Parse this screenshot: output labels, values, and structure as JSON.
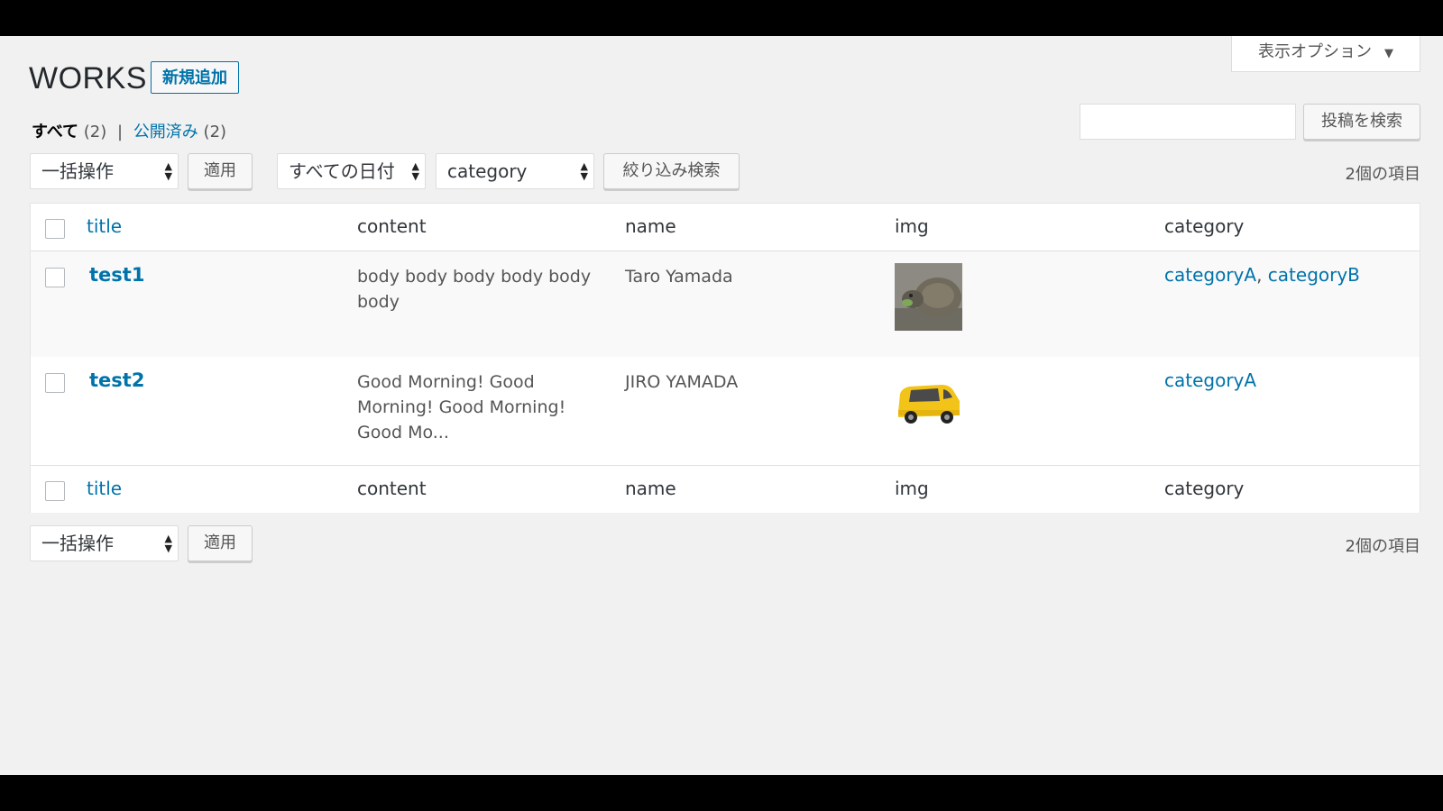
{
  "page": {
    "title": "WORKS",
    "add_new_label": "新規追加"
  },
  "screen_options": {
    "label": "表示オプション",
    "arrow": "▼"
  },
  "views": {
    "all_label": "すべて",
    "all_count": "(2)",
    "separator": "|",
    "published_label": "公開済み",
    "published_count": "(2)"
  },
  "search": {
    "button_label": "投稿を検索",
    "value": ""
  },
  "filters": {
    "bulk_action": "一括操作",
    "apply_label": "適用",
    "date_filter": "すべての日付",
    "category_filter": "category",
    "filter_button": "絞り込み検索"
  },
  "item_count": "2個の項目",
  "columns": {
    "title": "title",
    "content": "content",
    "name": "name",
    "img": "img",
    "category": "category"
  },
  "rows": [
    {
      "title": "test1",
      "content": "body body body body body body",
      "name": "Taro Yamada",
      "img": "tortoise-thumbnail",
      "categories": [
        "categoryA",
        "categoryB"
      ]
    },
    {
      "title": "test2",
      "content": "Good Morning! Good Morning! Good Morning! Good Mo...",
      "name": "JIRO YAMADA",
      "img": "yellow-car-thumbnail",
      "categories": [
        "categoryA"
      ]
    }
  ],
  "bottom_filters": {
    "bulk_action": "一括操作",
    "apply_label": "適用"
  },
  "bottom_item_count": "2個の項目",
  "colors": {
    "link": "#0073aa",
    "background": "#f1f1f1"
  }
}
